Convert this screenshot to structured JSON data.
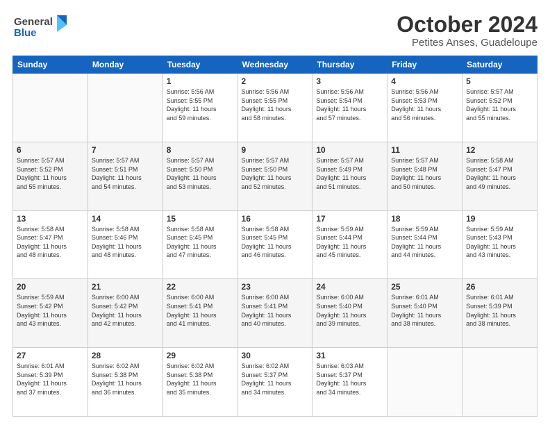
{
  "header": {
    "logo_line1": "General",
    "logo_line2": "Blue",
    "title": "October 2024",
    "subtitle": "Petites Anses, Guadeloupe"
  },
  "columns": [
    "Sunday",
    "Monday",
    "Tuesday",
    "Wednesday",
    "Thursday",
    "Friday",
    "Saturday"
  ],
  "weeks": [
    {
      "days": [
        {
          "num": "",
          "info": ""
        },
        {
          "num": "",
          "info": ""
        },
        {
          "num": "1",
          "info": "Sunrise: 5:56 AM\nSunset: 5:55 PM\nDaylight: 11 hours\nand 59 minutes."
        },
        {
          "num": "2",
          "info": "Sunrise: 5:56 AM\nSunset: 5:55 PM\nDaylight: 11 hours\nand 58 minutes."
        },
        {
          "num": "3",
          "info": "Sunrise: 5:56 AM\nSunset: 5:54 PM\nDaylight: 11 hours\nand 57 minutes."
        },
        {
          "num": "4",
          "info": "Sunrise: 5:56 AM\nSunset: 5:53 PM\nDaylight: 11 hours\nand 56 minutes."
        },
        {
          "num": "5",
          "info": "Sunrise: 5:57 AM\nSunset: 5:52 PM\nDaylight: 11 hours\nand 55 minutes."
        }
      ]
    },
    {
      "days": [
        {
          "num": "6",
          "info": "Sunrise: 5:57 AM\nSunset: 5:52 PM\nDaylight: 11 hours\nand 55 minutes."
        },
        {
          "num": "7",
          "info": "Sunrise: 5:57 AM\nSunset: 5:51 PM\nDaylight: 11 hours\nand 54 minutes."
        },
        {
          "num": "8",
          "info": "Sunrise: 5:57 AM\nSunset: 5:50 PM\nDaylight: 11 hours\nand 53 minutes."
        },
        {
          "num": "9",
          "info": "Sunrise: 5:57 AM\nSunset: 5:50 PM\nDaylight: 11 hours\nand 52 minutes."
        },
        {
          "num": "10",
          "info": "Sunrise: 5:57 AM\nSunset: 5:49 PM\nDaylight: 11 hours\nand 51 minutes."
        },
        {
          "num": "11",
          "info": "Sunrise: 5:57 AM\nSunset: 5:48 PM\nDaylight: 11 hours\nand 50 minutes."
        },
        {
          "num": "12",
          "info": "Sunrise: 5:58 AM\nSunset: 5:47 PM\nDaylight: 11 hours\nand 49 minutes."
        }
      ]
    },
    {
      "days": [
        {
          "num": "13",
          "info": "Sunrise: 5:58 AM\nSunset: 5:47 PM\nDaylight: 11 hours\nand 48 minutes."
        },
        {
          "num": "14",
          "info": "Sunrise: 5:58 AM\nSunset: 5:46 PM\nDaylight: 11 hours\nand 48 minutes."
        },
        {
          "num": "15",
          "info": "Sunrise: 5:58 AM\nSunset: 5:45 PM\nDaylight: 11 hours\nand 47 minutes."
        },
        {
          "num": "16",
          "info": "Sunrise: 5:58 AM\nSunset: 5:45 PM\nDaylight: 11 hours\nand 46 minutes."
        },
        {
          "num": "17",
          "info": "Sunrise: 5:59 AM\nSunset: 5:44 PM\nDaylight: 11 hours\nand 45 minutes."
        },
        {
          "num": "18",
          "info": "Sunrise: 5:59 AM\nSunset: 5:44 PM\nDaylight: 11 hours\nand 44 minutes."
        },
        {
          "num": "19",
          "info": "Sunrise: 5:59 AM\nSunset: 5:43 PM\nDaylight: 11 hours\nand 43 minutes."
        }
      ]
    },
    {
      "days": [
        {
          "num": "20",
          "info": "Sunrise: 5:59 AM\nSunset: 5:42 PM\nDaylight: 11 hours\nand 43 minutes."
        },
        {
          "num": "21",
          "info": "Sunrise: 6:00 AM\nSunset: 5:42 PM\nDaylight: 11 hours\nand 42 minutes."
        },
        {
          "num": "22",
          "info": "Sunrise: 6:00 AM\nSunset: 5:41 PM\nDaylight: 11 hours\nand 41 minutes."
        },
        {
          "num": "23",
          "info": "Sunrise: 6:00 AM\nSunset: 5:41 PM\nDaylight: 11 hours\nand 40 minutes."
        },
        {
          "num": "24",
          "info": "Sunrise: 6:00 AM\nSunset: 5:40 PM\nDaylight: 11 hours\nand 39 minutes."
        },
        {
          "num": "25",
          "info": "Sunrise: 6:01 AM\nSunset: 5:40 PM\nDaylight: 11 hours\nand 38 minutes."
        },
        {
          "num": "26",
          "info": "Sunrise: 6:01 AM\nSunset: 5:39 PM\nDaylight: 11 hours\nand 38 minutes."
        }
      ]
    },
    {
      "days": [
        {
          "num": "27",
          "info": "Sunrise: 6:01 AM\nSunset: 5:39 PM\nDaylight: 11 hours\nand 37 minutes."
        },
        {
          "num": "28",
          "info": "Sunrise: 6:02 AM\nSunset: 5:38 PM\nDaylight: 11 hours\nand 36 minutes."
        },
        {
          "num": "29",
          "info": "Sunrise: 6:02 AM\nSunset: 5:38 PM\nDaylight: 11 hours\nand 35 minutes."
        },
        {
          "num": "30",
          "info": "Sunrise: 6:02 AM\nSunset: 5:37 PM\nDaylight: 11 hours\nand 34 minutes."
        },
        {
          "num": "31",
          "info": "Sunrise: 6:03 AM\nSunset: 5:37 PM\nDaylight: 11 hours\nand 34 minutes."
        },
        {
          "num": "",
          "info": ""
        },
        {
          "num": "",
          "info": ""
        }
      ]
    }
  ]
}
